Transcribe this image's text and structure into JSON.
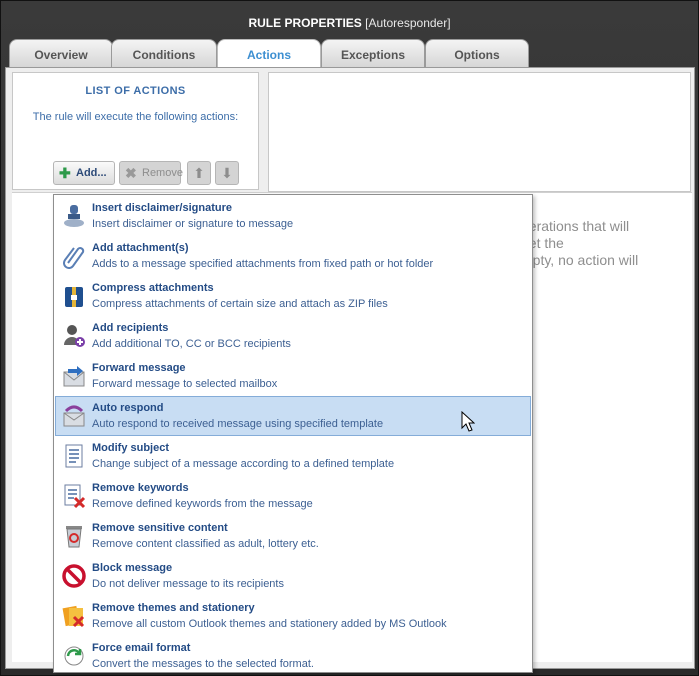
{
  "window": {
    "title": "RULE PROPERTIES",
    "subtitle": "[Autoresponder]"
  },
  "tabs": [
    {
      "label": "Overview",
      "active": false
    },
    {
      "label": "Conditions",
      "active": false
    },
    {
      "label": "Actions",
      "active": true
    },
    {
      "label": "Exceptions",
      "active": false
    },
    {
      "label": "Options",
      "active": false
    }
  ],
  "list_panel": {
    "title": "LIST OF ACTIONS",
    "description": "The rule will execute the following actions:",
    "add_label": "Add...",
    "remove_label": "Remove"
  },
  "background_text": "perations that will\neet the\nmpty, no action will",
  "actions_menu": [
    {
      "name": "Insert disclaimer/signature",
      "desc": "Insert disclaimer or signature to message",
      "icon": "stamp-icon"
    },
    {
      "name": "Add attachment(s)",
      "desc": "Adds to a message specified attachments from fixed path or hot folder",
      "icon": "paperclip-icon"
    },
    {
      "name": "Compress attachments",
      "desc": "Compress attachments of certain size and attach as ZIP files",
      "icon": "zip-archive-icon"
    },
    {
      "name": "Add recipients",
      "desc": "Add additional TO, CC or BCC recipients",
      "icon": "add-user-icon"
    },
    {
      "name": "Forward message",
      "desc": "Forward message to selected mailbox",
      "icon": "forward-mail-icon"
    },
    {
      "name": "Auto respond",
      "desc": "Auto respond to received message using specified template",
      "icon": "auto-respond-icon",
      "selected": true
    },
    {
      "name": "Modify subject",
      "desc": "Change subject of a message according to a defined template",
      "icon": "document-icon"
    },
    {
      "name": "Remove keywords",
      "desc": "Remove defined keywords from the message",
      "icon": "remove-keywords-icon"
    },
    {
      "name": "Remove sensitive content",
      "desc": "Remove content classified as adult, lottery etc.",
      "icon": "recycle-bin-icon"
    },
    {
      "name": "Block message",
      "desc": "Do not deliver message to its recipients",
      "icon": "block-icon"
    },
    {
      "name": "Remove themes and stationery",
      "desc": "Remove all custom Outlook themes and stationery added by MS Outlook",
      "icon": "remove-themes-icon"
    },
    {
      "name": "Force email format",
      "desc": "Convert the messages to the selected format.",
      "icon": "force-format-icon"
    }
  ],
  "colors": {
    "accent": "#3d8fd1",
    "link_text": "#234b85",
    "selected_bg": "#c8ddf3"
  }
}
